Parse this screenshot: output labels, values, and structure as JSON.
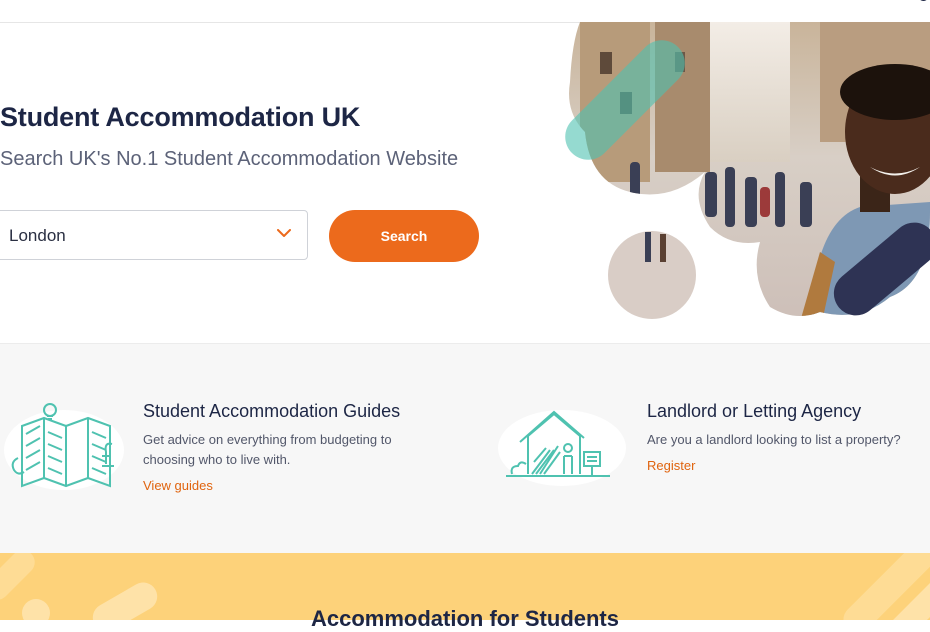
{
  "hero": {
    "title": "Student Accommodation UK",
    "subtitle": "Search UK's No.1 Student Accommodation Website",
    "location_value": "London",
    "search_label": "Search"
  },
  "features": [
    {
      "title": "Student Accommodation Guides",
      "text": "Get advice on everything from budgeting to choosing who to live with.",
      "link": "View guides",
      "icon": "map-guide-icon"
    },
    {
      "title": "Landlord or Letting Agency",
      "text": "Are you a landlord looking to list a property?",
      "link": "Register",
      "icon": "house-landlord-icon"
    }
  ],
  "section": {
    "title": "Accommodation for Students"
  },
  "colors": {
    "accent": "#ec6a1c",
    "link": "#e0640f",
    "navy": "#1d2645",
    "teal": "#4fc2b0",
    "band_yellow": "#fdd27a"
  }
}
